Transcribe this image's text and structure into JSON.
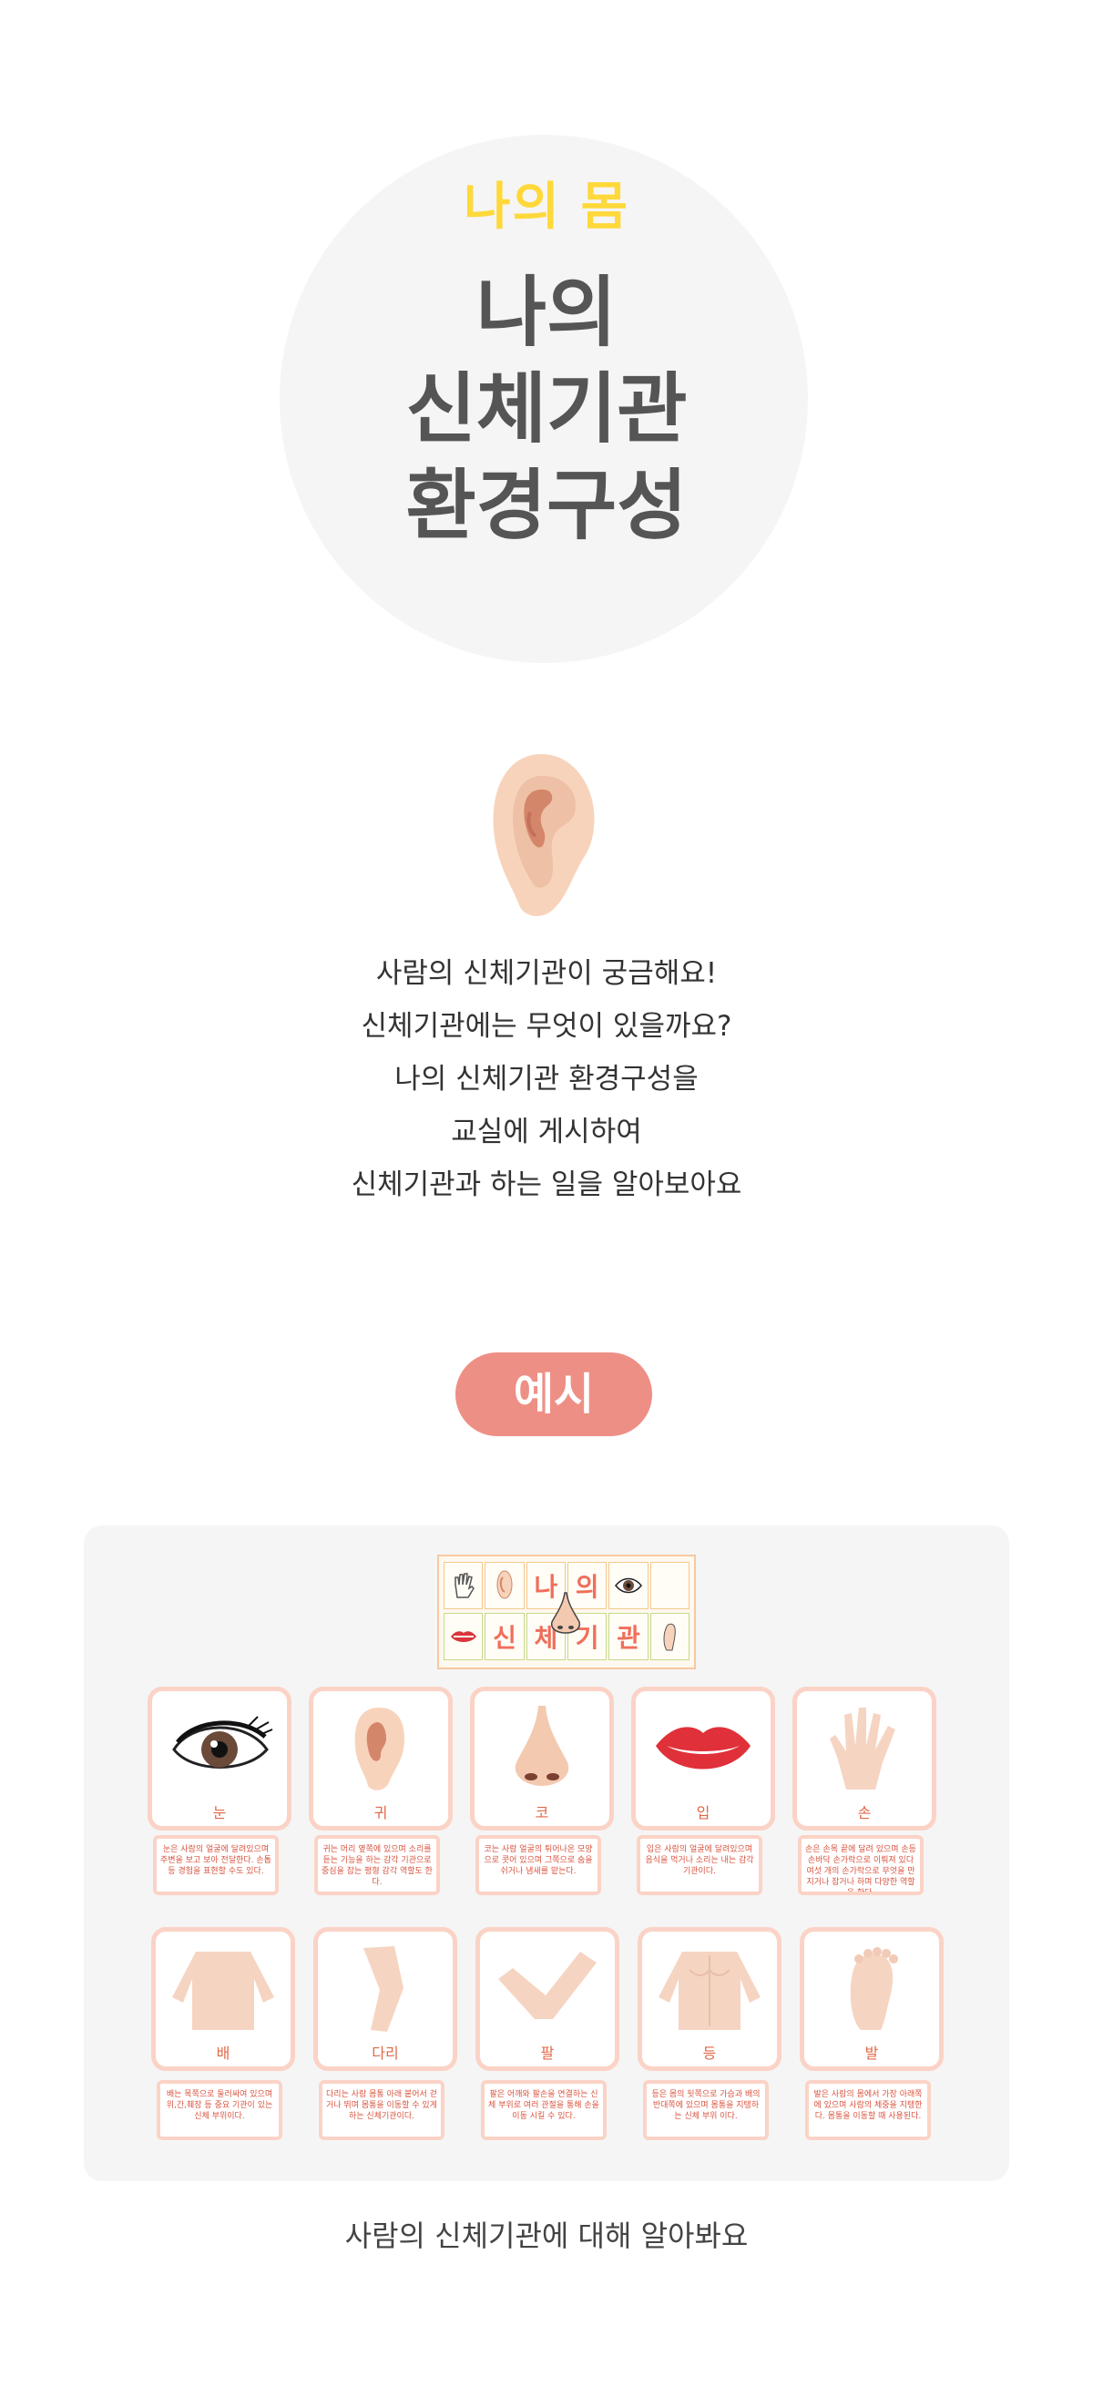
{
  "hero": {
    "subtitle": "나의 몸",
    "title_lines": [
      "나의",
      "신체기관",
      "환경구성"
    ]
  },
  "intro": {
    "lines": [
      "사람의 신체기관이 궁금해요!",
      "신체기관에는 무엇이 있을까요?",
      "나의 신체기관 환경구성을",
      "교실에 게시하여",
      "신체기관과 하는 일을 알아보아요"
    ]
  },
  "example_button": "예시",
  "banner": {
    "row1": [
      "나",
      "의"
    ],
    "row2": [
      "신",
      "체",
      "기",
      "관"
    ]
  },
  "cards_row1": [
    {
      "label": "눈",
      "icon": "eye-icon",
      "desc": "눈은 사람의 얼굴에 달려있으며 주변을 보고 보아 전달한다. 손톱 등 경험을 표현할 수도 있다."
    },
    {
      "label": "귀",
      "icon": "ear-icon",
      "desc": "귀는 머리 옆쪽에 있으며 소리를 듣는 기능을 하는 감각 기관으로 중심을 잡는 평형 감각 역할도 한다."
    },
    {
      "label": "코",
      "icon": "nose-icon",
      "desc": "코는 사람 얼굴의 튀어나온 모양으로 콧어 있으며 그쪽으로 숨을 쉬거나 냄새를 맡는다."
    },
    {
      "label": "입",
      "icon": "lips-icon",
      "desc": "입은 사람의 얼굴에 달려있으며 음식을 먹거나 소리는 내는 감각기관이다."
    },
    {
      "label": "손",
      "icon": "hand-icon",
      "desc": "손은 손목 끝에 달려 있으며 손등 손바닥 손가락으로 이뤄져 있다 여섯 개의 손가락으로 무엇을 만지거나 잡거나 하며 다양한 역할을 한다."
    }
  ],
  "cards_row2": [
    {
      "label": "배",
      "icon": "belly-icon",
      "desc": "배는 목쪽으로 둘러싸여 있으며 위,간,췌장 등 중요 기관이 있는 신체 부위이다."
    },
    {
      "label": "다리",
      "icon": "leg-icon",
      "desc": "다리는 사람 몸통 아래 붙어서 걷거나 뛰며 몸통을 이동할 수 있게 하는 신체기관이다."
    },
    {
      "label": "팔",
      "icon": "arm-icon",
      "desc": "팔은 어깨와 팔손을 연결하는 신체 부위로 여러 관절을 통해 손을 이동 시킬 수 있다."
    },
    {
      "label": "등",
      "icon": "back-icon",
      "desc": "등은 몸의 뒷쪽으로 가슴과 배의 반대쪽에 있으며 몸통을 지탱하는 신체 부위 이다."
    },
    {
      "label": "발",
      "icon": "foot-icon",
      "desc": "발은 사람의 몸에서 가장 아래쪽에 있으며 사람의 체중을 지탱한다. 몸통을 이동할 때 사용된다."
    }
  ],
  "caption": "사람의 신체기관에 대해 알아봐요",
  "colors": {
    "accent_yellow": "#ffd83a",
    "title_gray": "#555555",
    "pill_coral": "#ee8f86",
    "card_border": "#fbd3c6",
    "label_red": "#e0694a"
  }
}
